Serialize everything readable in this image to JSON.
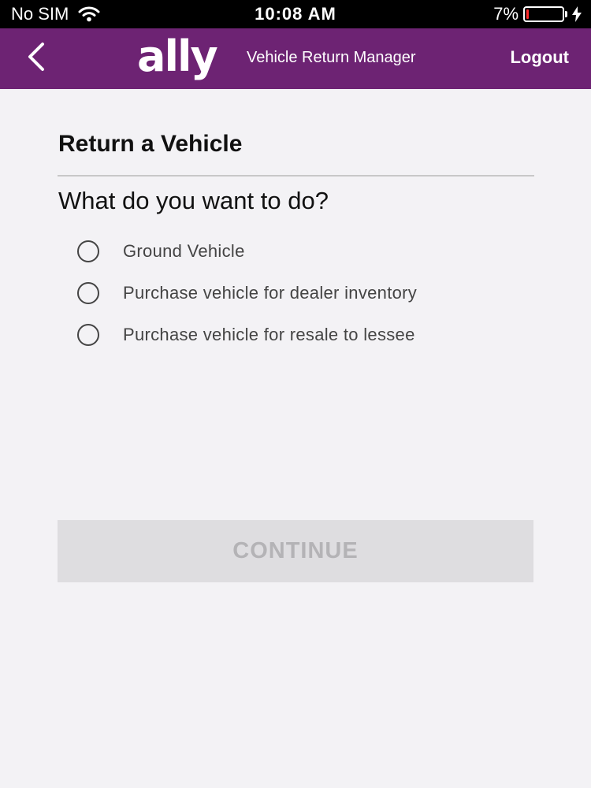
{
  "status_bar": {
    "carrier": "No SIM",
    "time": "10:08 AM",
    "battery_percent": "7%",
    "battery_level": 0.07,
    "icons": [
      "wifi-icon",
      "battery-icon",
      "charging-bolt-icon"
    ]
  },
  "header": {
    "brand": "ally",
    "title": "Vehicle Return Manager",
    "logout_label": "Logout",
    "back_icon": "chevron-left-icon",
    "color": "#6d2373"
  },
  "main": {
    "page_title": "Return a Vehicle",
    "question": "What do you want to do?",
    "options": [
      {
        "label": "Ground Vehicle",
        "selected": false
      },
      {
        "label": "Purchase vehicle for dealer inventory",
        "selected": false
      },
      {
        "label": "Purchase vehicle for resale to lessee",
        "selected": false
      }
    ],
    "continue_label": "CONTINUE",
    "continue_enabled": false
  }
}
